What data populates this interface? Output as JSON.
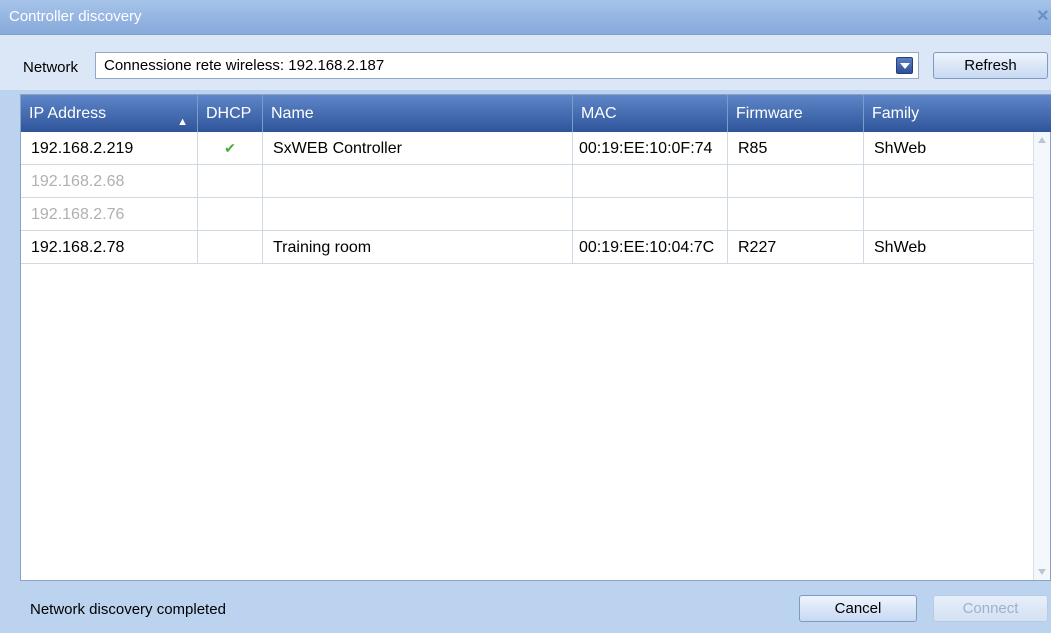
{
  "window": {
    "title": "Controller discovery",
    "close_symbol": "×"
  },
  "network": {
    "label": "Network",
    "selected": "Connessione rete wireless: 192.168.2.187",
    "refresh_label": "Refresh"
  },
  "table": {
    "columns": [
      "IP Address",
      "DHCP",
      "Name",
      "MAC",
      "Firmware",
      "Family"
    ],
    "sort_indicator": "▲",
    "rows": [
      {
        "ip": "192.168.2.219",
        "dhcp": "✔",
        "name": "SxWEB Controller",
        "mac": "00:19:EE:10:0F:74",
        "firmware": "R85",
        "family": "ShWeb"
      },
      {
        "ip": "192.168.2.68",
        "dhcp": "",
        "name": "",
        "mac": "",
        "firmware": "",
        "family": ""
      },
      {
        "ip": "192.168.2.76",
        "dhcp": "",
        "name": "",
        "mac": "",
        "firmware": "",
        "family": ""
      },
      {
        "ip": "192.168.2.78",
        "dhcp": "",
        "name": "Training room",
        "mac": "00:19:EE:10:04:7C",
        "firmware": "R227",
        "family": "ShWeb"
      }
    ]
  },
  "status": {
    "text": "Network discovery completed"
  },
  "buttons": {
    "cancel": "Cancel",
    "connect": "Connect"
  },
  "colors": {
    "header": "#3f66ad",
    "check": "#4daa3a"
  }
}
